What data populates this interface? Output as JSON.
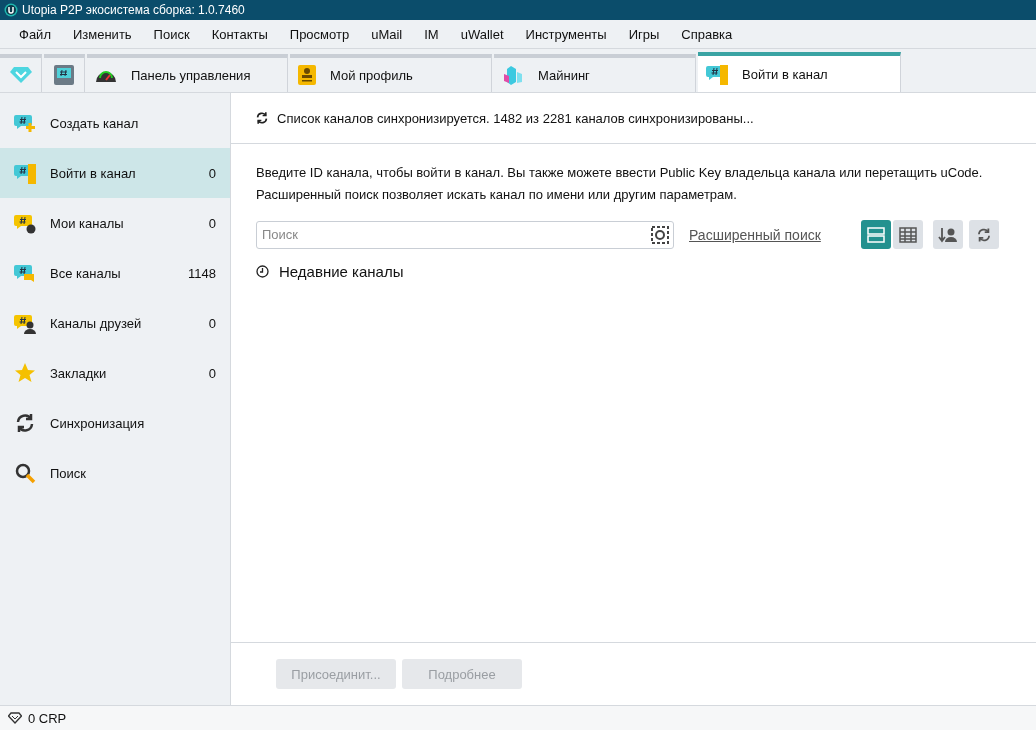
{
  "window": {
    "title": "Utopia P2P экосистема сборка: 1.0.7460"
  },
  "menu": [
    "Файл",
    "Изменить",
    "Поиск",
    "Контакты",
    "Просмотр",
    "uMail",
    "IM",
    "uWallet",
    "Инструменты",
    "Игры",
    "Справка"
  ],
  "tabs": [
    {
      "selected": false
    },
    {
      "selected": false
    },
    {
      "label": "Панель управления",
      "selected": false
    },
    {
      "label": "Мой профиль",
      "selected": false
    },
    {
      "label": "Майнинг",
      "selected": false
    },
    {
      "label": "Войти в канал",
      "selected": true
    }
  ],
  "sidebar": {
    "items": [
      {
        "label": "Создать канал",
        "selected": false
      },
      {
        "label": "Войти в канал",
        "count": "0",
        "selected": true
      },
      {
        "label": "Мои каналы",
        "count": "0",
        "selected": false
      },
      {
        "label": "Все каналы",
        "count": "1148",
        "selected": false
      },
      {
        "label": "Каналы друзей",
        "count": "0",
        "selected": false
      },
      {
        "label": "Закладки",
        "count": "0",
        "selected": false
      },
      {
        "label": "Синхронизация",
        "selected": false
      },
      {
        "label": "Поиск",
        "selected": false
      }
    ]
  },
  "sync_status": "Список каналов синхронизируется. 1482 из 2281 каналов синхронизированы...",
  "description": [
    "Введите ID канала, чтобы войти в канал. Вы также можете ввести Public Key владельца канала или перетащить uCode.",
    "Расширенный поиск позволяет искать канал по имени или другим параметрам."
  ],
  "search": {
    "placeholder": "Поиск"
  },
  "advanced_search_link": "Расширенный поиск",
  "view_modes": [
    {
      "selected": true
    },
    {
      "selected": false
    }
  ],
  "recent_channels": "Недавние каналы",
  "buttons": [
    {
      "label": "Присоединит...",
      "disabled": true
    },
    {
      "label": "Подробнее",
      "disabled": true
    }
  ],
  "status_bar": {
    "balance": "0 CRP"
  }
}
